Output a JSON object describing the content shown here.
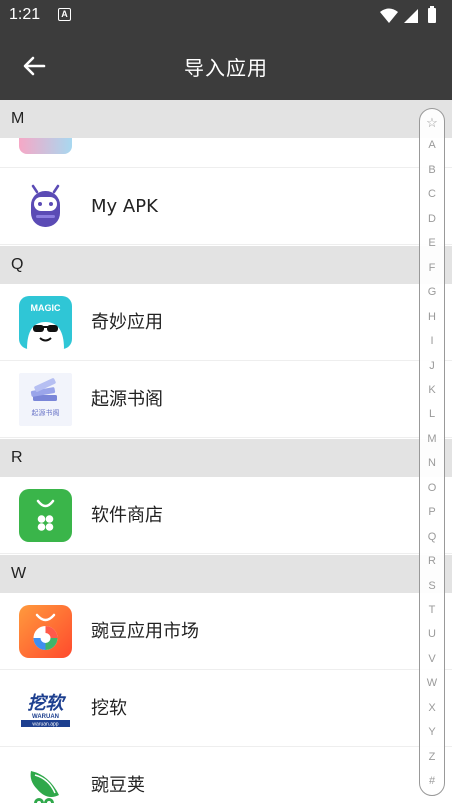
{
  "status_bar": {
    "time": "1:21",
    "notification_badge": "A"
  },
  "app_bar": {
    "title": "导入应用"
  },
  "sections": [
    {
      "header": "M",
      "apps": [
        {
          "name": "My APK"
        }
      ]
    },
    {
      "header": "Q",
      "apps": [
        {
          "name": "奇妙应用"
        },
        {
          "name": "起源书阁"
        }
      ]
    },
    {
      "header": "R",
      "apps": [
        {
          "name": "软件商店"
        }
      ]
    },
    {
      "header": "W",
      "apps": [
        {
          "name": "豌豆应用市场"
        },
        {
          "name": "挖软"
        },
        {
          "name": "豌豆荚"
        }
      ]
    }
  ],
  "icon_text": {
    "magic": "MAGIC",
    "wawa": "挖软",
    "wawa_sub": "WARUAN",
    "wawa_url": "waruan.app",
    "book": "起源书阁"
  },
  "alphabet_index": [
    "☆",
    "A",
    "B",
    "C",
    "D",
    "E",
    "F",
    "G",
    "H",
    "I",
    "J",
    "K",
    "L",
    "M",
    "N",
    "O",
    "P",
    "Q",
    "R",
    "S",
    "T",
    "U",
    "V",
    "W",
    "X",
    "Y",
    "Z",
    "#"
  ],
  "colors": {
    "app_bar": "#3c3c3c",
    "section_header": "#e3e3e3",
    "myapk_purple": "#5b4bb5",
    "magic_teal": "#2fc6d6",
    "store_green": "#3ab54a",
    "wandoujia_orange": "#ff6a3d"
  }
}
